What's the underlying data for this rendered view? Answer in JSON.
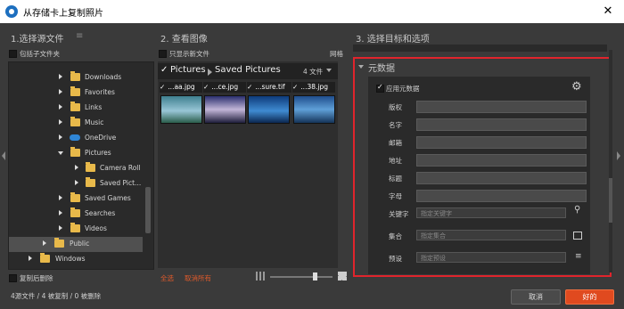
{
  "window": {
    "title": "从存储卡上复制照片",
    "close_icon": "✕"
  },
  "source": {
    "header": "1.选择源文件",
    "menu_icon": "≡",
    "include_subfolders": "包括子文件夹",
    "tree": [
      {
        "label": "Downloads"
      },
      {
        "label": "Favorites"
      },
      {
        "label": "Links"
      },
      {
        "label": "Music"
      },
      {
        "label": "OneDrive"
      },
      {
        "label": "Pictures"
      },
      {
        "label": "Camera Roll"
      },
      {
        "label": "Saved Pict..."
      },
      {
        "label": "Saved Games"
      },
      {
        "label": "Searches"
      },
      {
        "label": "Videos"
      },
      {
        "label": "Public"
      },
      {
        "label": "Windows"
      }
    ],
    "delete_after_copy": "复制后删除",
    "status": "4源文件 / 4 被复制 / 0 被删除"
  },
  "view": {
    "header": "2. 查看图像",
    "only_new_files": "只显示新文件",
    "grid_label": "网格",
    "path": [
      "Pictures",
      "Saved Pictures"
    ],
    "file_count": "4 文件",
    "files": [
      {
        "name": "...aa.jpg",
        "colors": [
          "#3e7f8f",
          "#98c6d6"
        ]
      },
      {
        "name": "...ce.jpg",
        "colors": [
          "#2b2f6f",
          "#c2b5d8"
        ]
      },
      {
        "name": "...sure.tif",
        "colors": [
          "#0e3a7a",
          "#3f8bd1"
        ]
      },
      {
        "name": "...38.jpg",
        "colors": [
          "#1f4d8c",
          "#5fa0d8"
        ]
      }
    ],
    "select_all": "全选",
    "deselect_all": "取消所有",
    "accent": "#e05a2b"
  },
  "target": {
    "header": "3. 选择目标和选项",
    "section": "元数据",
    "apply_metadata": "应用元数据",
    "fields": [
      "版权",
      "名字",
      "邮箱",
      "地址",
      "标题",
      "字母"
    ],
    "keywords": {
      "label": "关键字",
      "placeholder": "指定关键字"
    },
    "set": {
      "label": "集合",
      "placeholder": "指定集合"
    },
    "preset": {
      "label": "预设",
      "placeholder": "指定预设"
    },
    "highlight_color": "#e0242c"
  },
  "actions": {
    "cancel": "取消",
    "ok": "好的",
    "ok_color": "#e04a1f"
  }
}
